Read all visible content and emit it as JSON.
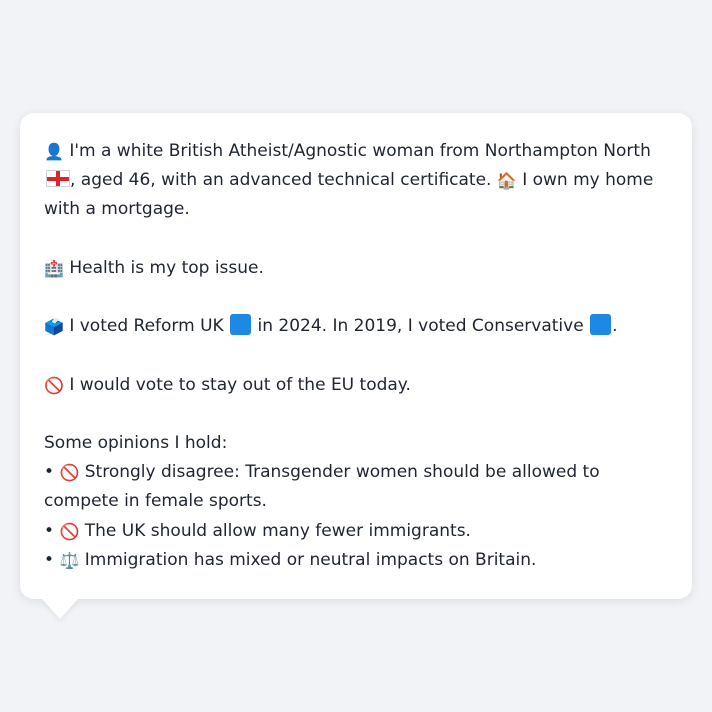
{
  "bubble": {
    "intro": {
      "part1": "I'm a white British Atheist/Agnostic woman from Northampton North",
      "part2": ", aged 46, with an advanced technical certificate.",
      "part3": "I own my home with a mortgage."
    },
    "health_text": "Health is my top issue.",
    "vote": {
      "part1": "I voted Reform UK",
      "part2": "in 2024. In 2019, I voted Conservative",
      "part3": "."
    },
    "eu_text": "I would vote to stay out of the EU today.",
    "opinions": {
      "heading": "Some opinions I hold:",
      "items": [
        {
          "bullet": "•",
          "text": "Strongly disagree: Transgender women should be allowed to compete in female sports."
        },
        {
          "bullet": "•",
          "text": "The UK should allow many fewer immigrants."
        },
        {
          "bullet": "•",
          "text": "Immigration has mixed or neutral impacts on Britain."
        }
      ]
    },
    "icons": {
      "person": "person-silhouette-icon",
      "flag": "england-flag-icon",
      "house": "house-icon",
      "hospital": "hospital-icon",
      "ballot": "ballot-box-icon",
      "square": "blue-square-icon",
      "no_entry": "prohibited-icon",
      "scales": "balance-scale-icon"
    },
    "glyphs": {
      "person": "👤",
      "house": "🏠",
      "hospital": "🏥",
      "ballot": "🗳️",
      "no_entry": "🚫",
      "scales": "⚖️"
    }
  },
  "colors": {
    "background": "#f1f3f6",
    "card": "#ffffff",
    "text": "#1f2530",
    "party_square": "#1e88e5",
    "flag_red": "#d8262d"
  }
}
